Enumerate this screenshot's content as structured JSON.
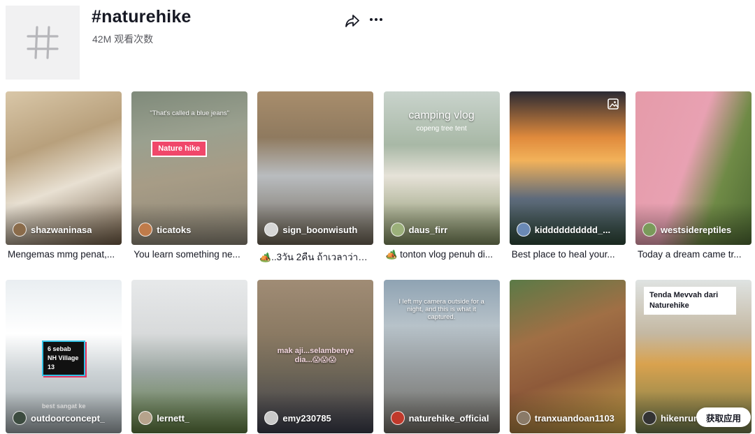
{
  "header": {
    "title": "#naturehike",
    "views": "42M 观看次数"
  },
  "colors": {
    "text": "#161823",
    "muted": "#58595f",
    "placeholder_bg": "#f1f1f2"
  },
  "videos": [
    {
      "author": "shazwaninasa",
      "desc": "Mengemas mmg penat,...",
      "bg": "linear-gradient(160deg,#d9c7a8 0%,#b8a07c 35%,#e8e0d2 60%,#6e5a43 100%)",
      "avatar": "#8a6b4a"
    },
    {
      "author": "ticatoks",
      "desc": "You learn something ne...",
      "bg": "linear-gradient(170deg,#7f8a7a 0%,#9aa08f 30%,#a79c86 55%,#8c8677 100%)",
      "avatar": "#c07b4a",
      "tag": "Nature hike",
      "caption_top": "\"That's called a blue jeans\""
    },
    {
      "author": "sign_boonwisuth",
      "desc": "🏕️..3วัน 2คืน ถ้าเวลาว่าง...",
      "bg": "linear-gradient(180deg,#a88d6c 0%,#8f7a5f 30%,#b9bcbf 55%,#6d6455 100%)",
      "avatar": "#d6d6d6"
    },
    {
      "author": "daus_firr",
      "desc": "🏕️ tonton vlog penuh di...",
      "bg": "linear-gradient(180deg,#c9d3cc 0%,#a8b8a6 35%,#e6e2d8 55%,#7d8a5e 100%)",
      "avatar": "#9bb07a",
      "caption_top": "camping vlog",
      "caption_sub": "copeng tree tent"
    },
    {
      "author": "kidddddddddd_...",
      "desc": "Best place to heal your...",
      "bg": "linear-gradient(180deg,#2b2a33 0%,#e08a3c 30%,#f2b25a 45%,#5d6a7b 70%,#2f4a3a 100%)",
      "avatar": "#6a89b5"
    },
    {
      "author": "westsidereptiles",
      "desc": "Today a dream came tr...",
      "bg": "linear-gradient(110deg,#e59ba9 0%,#e8a1b2 45%,#6f8a46 70%,#4f6b34 100%)",
      "avatar": "#7a9a5a"
    },
    {
      "author": "outdoorconcept_",
      "desc": "",
      "bg": "linear-gradient(180deg,#e9eef1 0%,#ffffff 35%,#cdd3d6 60%,#9aa3a7 100%)",
      "avatar": "#3c4b3f",
      "tag": "6 sebab NH Village 13",
      "caption_bottom": "best sangat ke"
    },
    {
      "author": "lernett_",
      "desc": "",
      "bg": "linear-gradient(180deg,#e7e9ea 0%,#d8dadb 35%,#9aa5a0 60%,#5e7a3f 100%)",
      "avatar": "#b6a38c"
    },
    {
      "author": "emy230785",
      "desc": "",
      "bg": "linear-gradient(180deg,#a08c75 0%,#8b7a63 35%,#6e6657 60%,#3a3c4a 100%)",
      "avatar": "#c9c9c9",
      "caption_mid": "mak aji...selambenye dia...😱😱😱"
    },
    {
      "author": "naturehike_official",
      "desc": "",
      "bg": "linear-gradient(180deg,#8fa3b3 0%,#b7c2c9 30%,#9aa0a3 55%,#6e6a63 100%)",
      "avatar": "#c0392b",
      "caption_top": "I left my camera outside for a night, and this is what it captured."
    },
    {
      "author": "tranxuandoan1103",
      "desc": "",
      "bg": "linear-gradient(160deg,#5b7a47 0%,#a06f45 35%,#8e5a3a 60%,#c9a64a 100%)",
      "avatar": "#8a7a68"
    },
    {
      "author": "hikenrun",
      "desc": "",
      "bg": "linear-gradient(180deg,#dfe3e2 0%,#c4b8a2 35%,#d9a24e 55%,#6f7a4c 100%)",
      "avatar": "#333333",
      "tag_dark": "Tenda Mevvah dari Naturehike"
    }
  ],
  "get_app": "获取应用"
}
